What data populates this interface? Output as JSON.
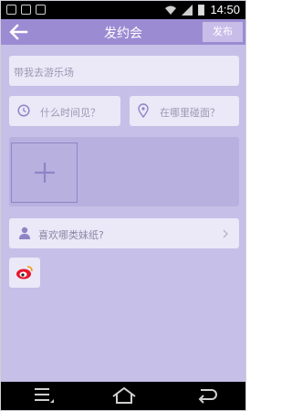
{
  "statusbar": {
    "time": "14:50"
  },
  "header": {
    "title": "发约会",
    "publish_label": "发布",
    "back_icon": "back-arrow-icon"
  },
  "form": {
    "place_placeholder": "带我去游乐场",
    "time_placeholder": "什么时间见？",
    "location_placeholder": "在哪里碰面？",
    "preference_label": "喜欢哪类妹纸?"
  },
  "colors": {
    "header": "#9b8bd3",
    "background": "#c6bfe7",
    "field": "#ebe8f7",
    "accent": "#8f84c6"
  },
  "icons": [
    "back-arrow-icon",
    "clock-icon",
    "location-pin-icon",
    "plus-icon",
    "person-icon",
    "chevron-right-icon",
    "weibo-icon",
    "menu-icon",
    "home-icon",
    "return-icon"
  ]
}
